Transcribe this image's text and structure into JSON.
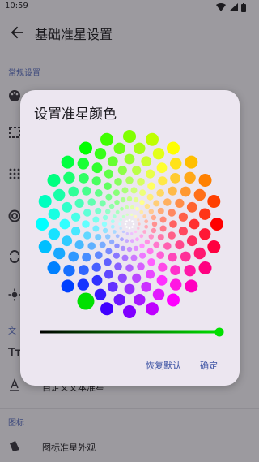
{
  "status_bar": {
    "time": "10:59"
  },
  "app_bar": {
    "title": "基础准星设置"
  },
  "sections": {
    "general": "常规设置",
    "text_partial": "文",
    "text_row_label": "自定义文本准星",
    "icon": "图标",
    "icon_row_label": "图标准星外观"
  },
  "dialog": {
    "title": "设置准星颜色",
    "reset_label": "恢复默认",
    "confirm_label": "确定",
    "brightness_level": 1.0,
    "selected_color": "#00e000"
  },
  "colors": {
    "accent": "#3f55a5",
    "scrim": "#9c9a9f",
    "dialog_bg": "#ece6f0"
  }
}
